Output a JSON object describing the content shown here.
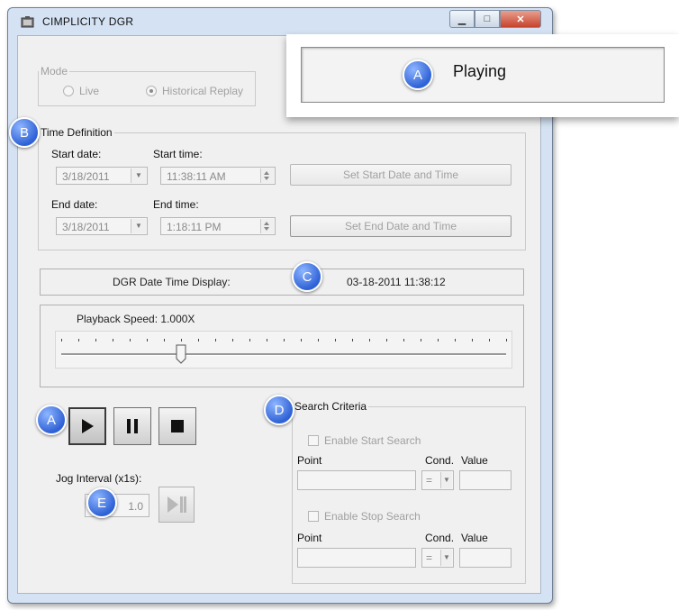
{
  "window": {
    "title": "CIMPLICITY DGR"
  },
  "callout": {
    "badge": "A",
    "status": "Playing"
  },
  "mode": {
    "legend": "Mode",
    "options": [
      {
        "label": "Live",
        "selected": false
      },
      {
        "label": "Historical Replay",
        "selected": true
      }
    ]
  },
  "time_definition": {
    "badge": "B",
    "legend": "Time Definition",
    "start_date_label": "Start date:",
    "start_date_value": "3/18/2011",
    "start_time_label": "Start time:",
    "start_time_value": "11:38:11 AM",
    "set_start_button": "Set Start Date and Time",
    "end_date_label": "End date:",
    "end_date_value": "3/18/2011",
    "end_time_label": "End time:",
    "end_time_value": "1:18:11 PM",
    "set_end_button": "Set End Date and Time"
  },
  "dgr_display": {
    "badge": "C",
    "label": "DGR Date Time Display:",
    "value": "03-18-2011 11:38:12"
  },
  "playback": {
    "label": "Playback Speed: 1.000X",
    "slider_fraction": 0.27
  },
  "controls": {
    "badge": "A",
    "play": "play-icon",
    "pause": "pause-icon",
    "stop": "stop-icon"
  },
  "jog": {
    "badge": "E",
    "label": "Jog Interval (x1s):",
    "value": "1.0"
  },
  "search": {
    "badge": "D",
    "legend": "Search Criteria",
    "enable_start": "Enable Start Search",
    "enable_stop": "Enable Stop Search",
    "point_label": "Point",
    "cond_label": "Cond.",
    "value_label": "Value",
    "cond_value": "="
  },
  "colors": {
    "badge": "#2f62d6",
    "frame": "#d4e2f3",
    "close": "#c7432d"
  }
}
